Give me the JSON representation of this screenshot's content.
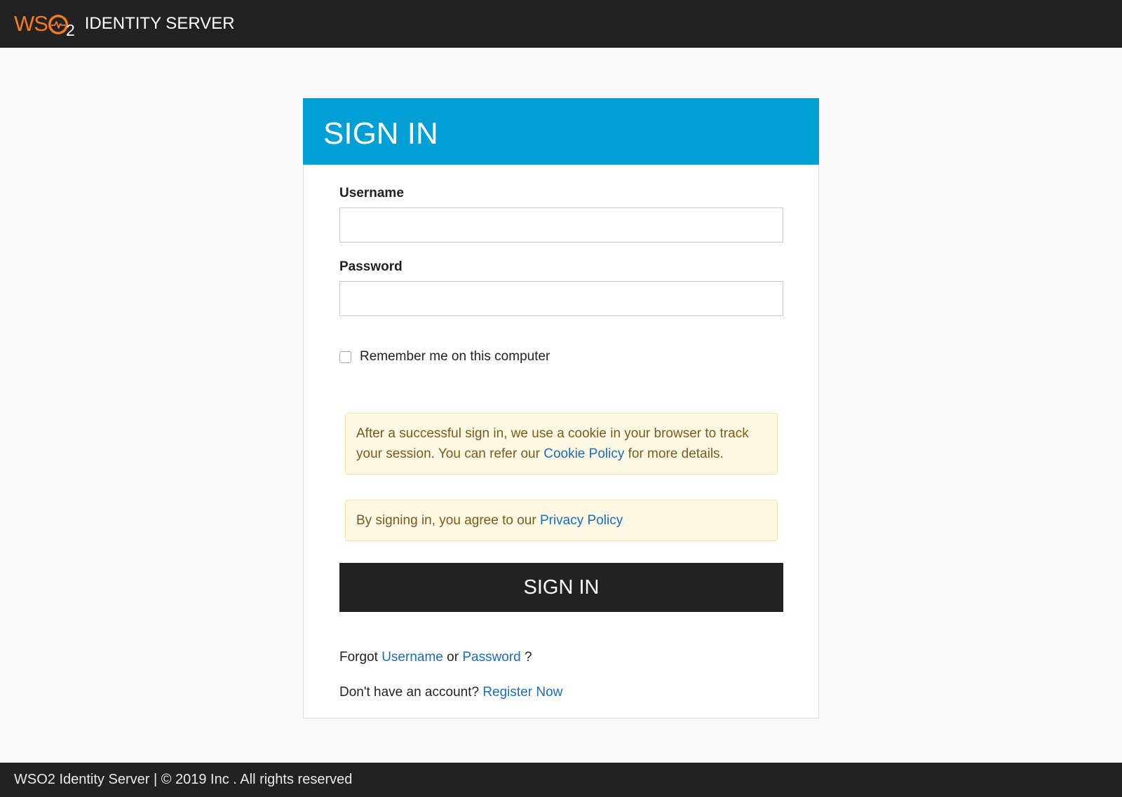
{
  "header": {
    "logo_ws": "WS",
    "logo_two": "2",
    "product_name": "IDENTITY SERVER"
  },
  "signin": {
    "title": "SIGN IN",
    "username_label": "Username",
    "username_value": "",
    "password_label": "Password",
    "password_value": "",
    "remember_label": "Remember me on this computer",
    "remember_checked": false,
    "cookie_notice_prefix": "After a successful sign in, we use a cookie in your browser to track your session. You can refer our",
    "cookie_policy_link": "Cookie Policy",
    "cookie_notice_suffix": "for more details.",
    "privacy_notice_prefix": "By signing in, you agree to our",
    "privacy_policy_link": "Privacy Policy",
    "submit_label": "SIGN IN",
    "forgot_prefix": "Forgot",
    "forgot_username_link": "Username",
    "forgot_or": "or",
    "forgot_password_link": "Password",
    "forgot_suffix": "?",
    "register_prefix": "Don't have an account?",
    "register_link": "Register Now"
  },
  "footer": {
    "text": "WSO2 Identity Server | © 2019 Inc . All rights reserved"
  },
  "colors": {
    "header_bg": "#222222",
    "brand_orange": "#f47b20",
    "card_header_bg": "#00a0d6",
    "notice_bg": "#fcf8e3",
    "notice_text": "#7a5b1e",
    "link": "#1a6cb8",
    "button_bg": "#222222"
  },
  "icons": {
    "logo": "wso2-logo-icon"
  }
}
